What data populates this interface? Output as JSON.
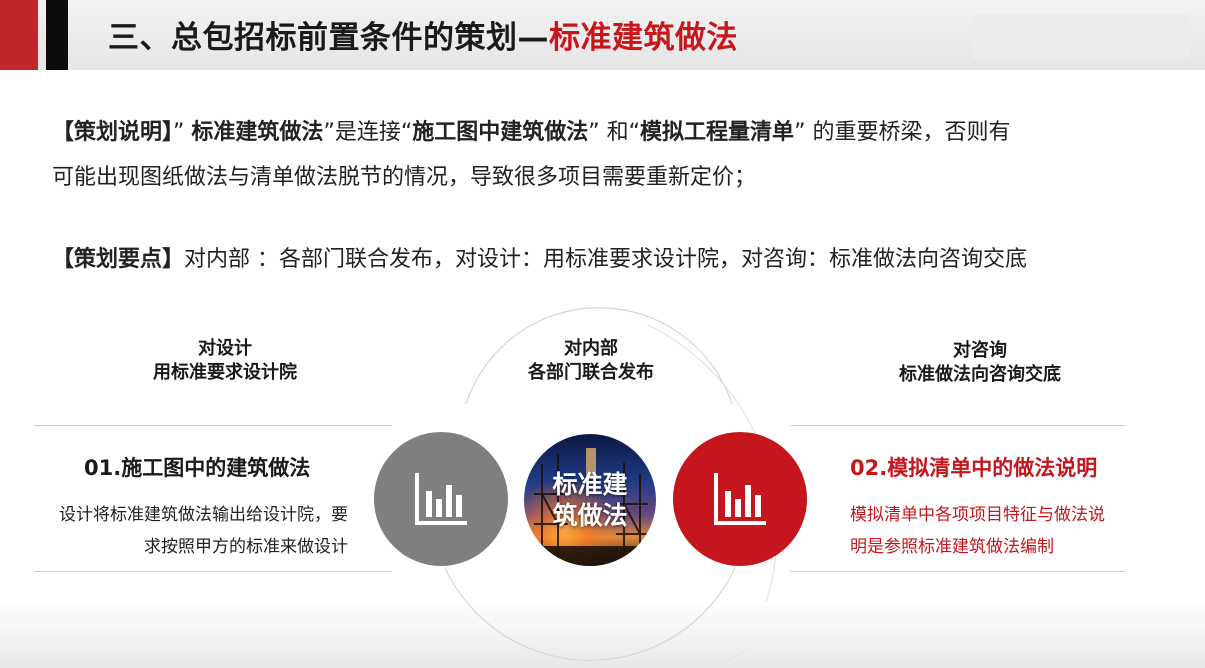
{
  "header": {
    "title_main": "三、总包招标前置条件的策划—",
    "title_accent": "标准建筑做法"
  },
  "description": {
    "tag": "【策划说明】",
    "q1_open": "”",
    "term1": "标准建筑做法",
    "mid1": "”是连接“",
    "term2": "施工图中建筑做法",
    "mid2": "” 和“",
    "term3": "模拟工程量清单",
    "tail": "” 的重要桥梁，否则有",
    "line2": "可能出现图纸做法与清单做法脱节的情况，导致很多项目需要重新定价；"
  },
  "keypoints": {
    "tag": "【策划要点】",
    "text": "对内部 ：各部门联合发布，对设计：用标准要求设计院，对咨询：标准做法向咨询交底"
  },
  "diagram": {
    "left_label": {
      "line1": "对设计",
      "line2": "用标准要求设计院"
    },
    "center_label": {
      "line1": "对内部",
      "line2": "各部门联合发布"
    },
    "right_label": {
      "line1": "对咨询",
      "line2": "标准做法向咨询交底"
    },
    "center_circle_text": {
      "line1": "标准建",
      "line2": "筑做法"
    },
    "left_item": {
      "title": "01.施工图中的建筑做法",
      "desc_line1": "设计将标准建筑做法输出给设计院，要",
      "desc_line2": "求按照甲方的标准来做设计"
    },
    "right_item": {
      "title": "02.模拟清单中的做法说明",
      "desc_line1": "模拟清单中各项项目特征与做法说",
      "desc_line2": "明是参照标准建筑做法编制"
    },
    "icons": [
      "bar-chart-icon",
      "bar-chart-icon"
    ],
    "colors": {
      "red": "#c4161c",
      "gray": "#7f7f7f"
    }
  }
}
